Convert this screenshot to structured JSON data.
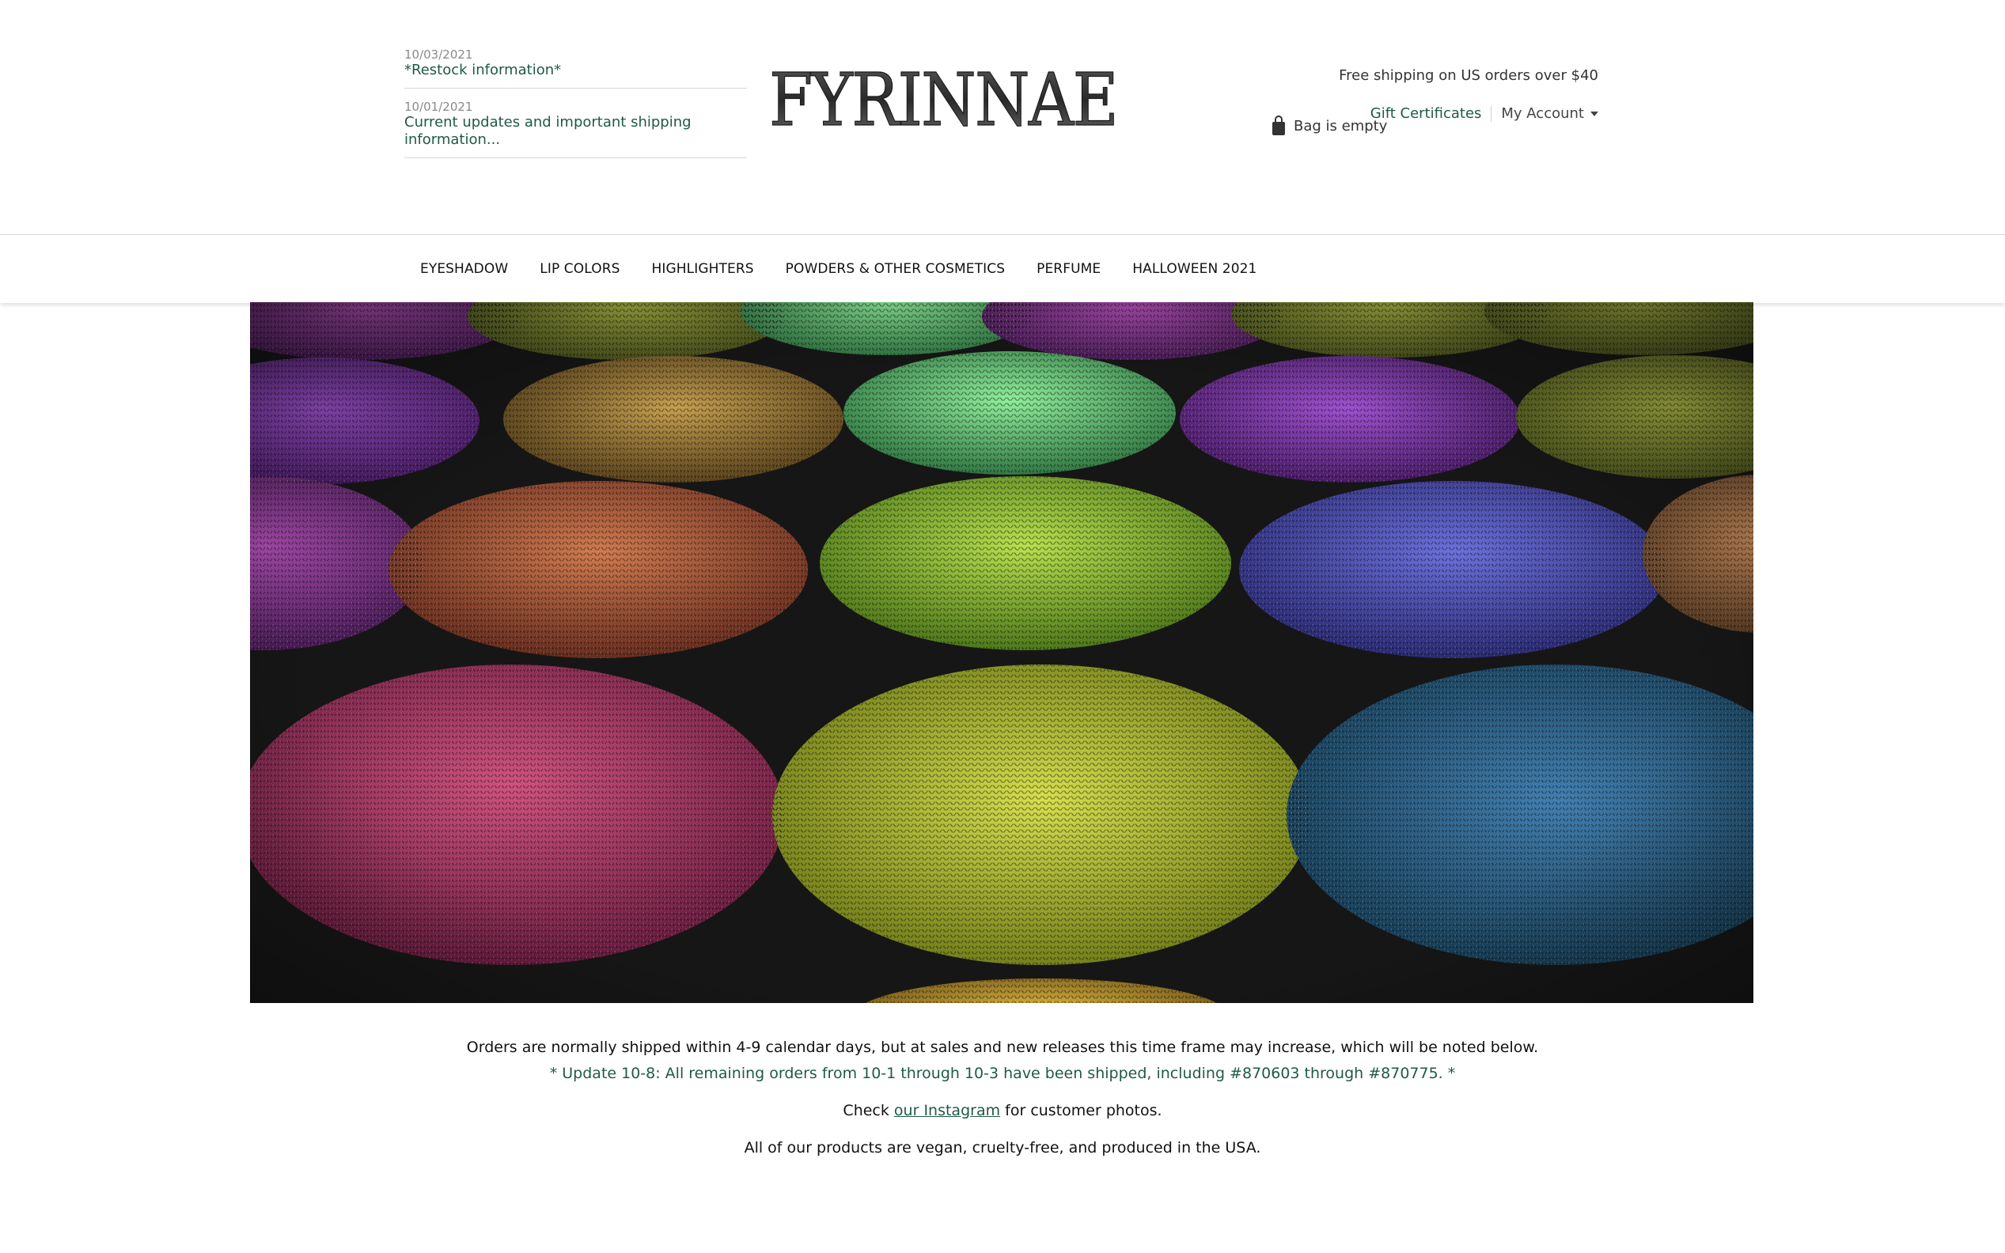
{
  "news": [
    {
      "date": "10/03/2021",
      "title": "*Restock information*"
    },
    {
      "date": "10/01/2021",
      "title": "Current updates and important shipping information..."
    }
  ],
  "logo": {
    "text": "FYRINNAE"
  },
  "header": {
    "promo": "Free shipping on US orders over $40",
    "gift_certificates": "Gift Certificates",
    "my_account": "My Account",
    "bag": "Bag is empty"
  },
  "nav": {
    "items": [
      "EYESHADOW",
      "LIP COLORS",
      "HIGHLIGHTERS",
      "POWDERS & OTHER COSMETICS",
      "PERFUME",
      "HALLOWEEN 2021"
    ]
  },
  "info": {
    "line1": "Orders are normally shipped within 4-9 calendar days, but at sales and new releases this time frame may increase, which will be noted below.",
    "line2": "* Update 10-8: All remaining orders from 10-1 through 10-3 have been shipped, including #870603 through #870775. *",
    "line3_prefix": "Check",
    "line3_link": "our Instagram",
    "line3_suffix": "for customer photos.",
    "line4": "All of our products are vegan, cruelty-free, and produced in the USA."
  },
  "colors": {
    "link_green": "#1f5a45",
    "hero_bg": "#0b0b0b"
  },
  "icons": {
    "bag": "shopping-bag-icon",
    "caret": "caret-down-icon"
  }
}
